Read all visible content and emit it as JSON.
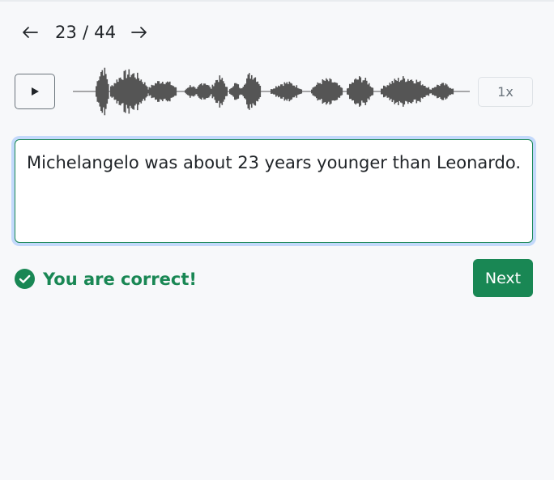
{
  "navigation": {
    "prev_icon": "arrow-left-icon",
    "next_icon": "arrow-right-icon",
    "counter": "23 / 44"
  },
  "player": {
    "play_icon": "play-icon",
    "speed_label": "1x"
  },
  "answer": {
    "text": "Michelangelo was about 23 years younger than Leonardo."
  },
  "feedback": {
    "icon": "check-circle-icon",
    "message": "You are correct!"
  },
  "actions": {
    "next_label": "Next"
  },
  "colors": {
    "success": "#198754",
    "waveform": "#555555",
    "focus_ring": "#9ec5fe"
  }
}
